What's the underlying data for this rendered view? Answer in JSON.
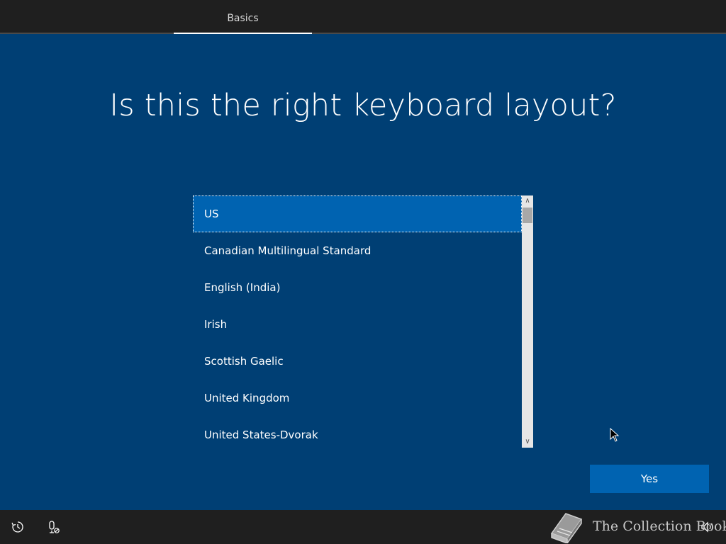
{
  "header": {
    "tabs": [
      {
        "label": "Basics",
        "active": true
      }
    ]
  },
  "main": {
    "title": "Is this the right keyboard layout?",
    "layouts": [
      {
        "label": "US",
        "selected": true
      },
      {
        "label": "Canadian Multilingual Standard",
        "selected": false
      },
      {
        "label": "English (India)",
        "selected": false
      },
      {
        "label": "Irish",
        "selected": false
      },
      {
        "label": "Scottish Gaelic",
        "selected": false
      },
      {
        "label": "United Kingdom",
        "selected": false
      },
      {
        "label": "United States-Dvorak",
        "selected": false
      }
    ],
    "yes_label": "Yes"
  },
  "footer": {
    "icons": [
      "ease-of-access-icon",
      "microphone-off-icon",
      "speaker-icon"
    ],
    "watermark_text": "The Collection Book"
  },
  "colors": {
    "background": "#003f74",
    "accent": "#0063b1",
    "topbar": "#1f1f1f"
  }
}
